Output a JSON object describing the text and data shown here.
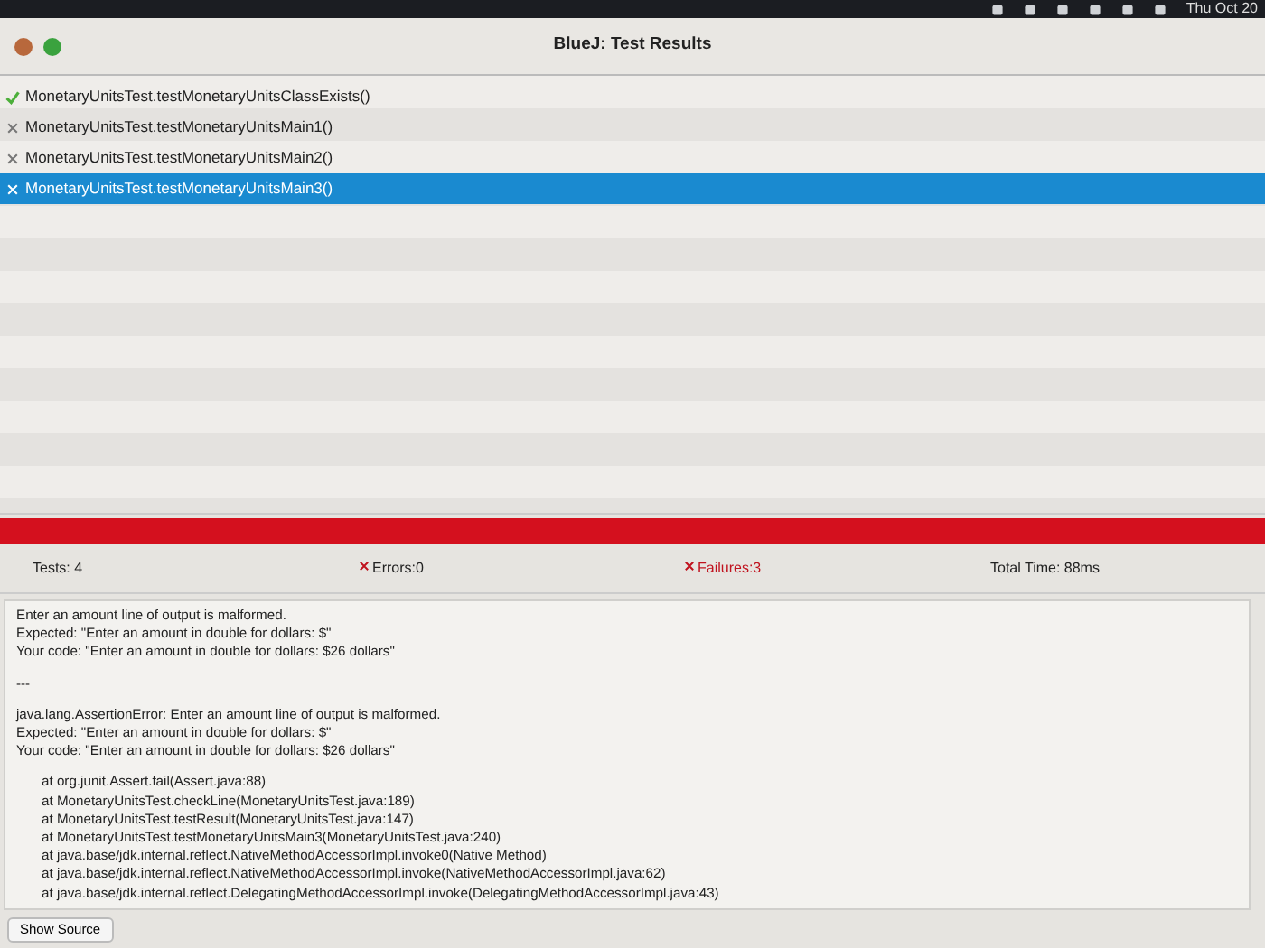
{
  "menu_bar": {
    "clock": "Thu Oct 20"
  },
  "window": {
    "title": "BlueJ:  Test Results"
  },
  "tests": [
    {
      "name": "MonetaryUnitsTest.testMonetaryUnitsClassExists()",
      "kind": "pass",
      "selected": false
    },
    {
      "name": "MonetaryUnitsTest.testMonetaryUnitsMain1()",
      "kind": "fail",
      "selected": false
    },
    {
      "name": "MonetaryUnitsTest.testMonetaryUnitsMain2()",
      "kind": "fail",
      "selected": false
    },
    {
      "name": "MonetaryUnitsTest.testMonetaryUnitsMain3()",
      "kind": "fail",
      "selected": true
    }
  ],
  "progress": {
    "level": 1,
    "kind": "failed"
  },
  "summary": {
    "tests": "Tests:  4",
    "errors": "Errors:0",
    "failures": "Failures:3",
    "total_time": "Total Time:  88ms"
  },
  "details": {
    "blocks": [
      [
        "Enter an amount line of output is malformed.",
        "Expected:  \"Enter an amount in double for dollars: $\"",
        "Your code: \"Enter an amount in double for dollars: $26 dollars\""
      ],
      [
        "---"
      ],
      [
        "java.lang.AssertionError:  Enter an amount line of output is malformed.",
        "Expected:  \"Enter an amount in double for dollars: $\"",
        "Your code: \"Enter an amount in double for dollars: $26 dollars\""
      ],
      [
        "at org.junit.Assert.fail(Assert.java:88)",
        "at MonetaryUnitsTest.checkLine(MonetaryUnitsTest.java:189)",
        "at MonetaryUnitsTest.testResult(MonetaryUnitsTest.java:147)",
        "at MonetaryUnitsTest.testMonetaryUnitsMain3(MonetaryUnitsTest.java:240)",
        "at java.base/jdk.internal.reflect.NativeMethodAccessorImpl.invoke0(Native Method)",
        "at java.base/jdk.internal.reflect.NativeMethodAccessorImpl.invoke(NativeMethodAccessorImpl.java:62)",
        "at java.base/jdk.internal.reflect.DelegatingMethodAccessorImpl.invoke(DelegatingMethodAccessorImpl.java:43)"
      ]
    ]
  },
  "show_source_button": "Show Source"
}
